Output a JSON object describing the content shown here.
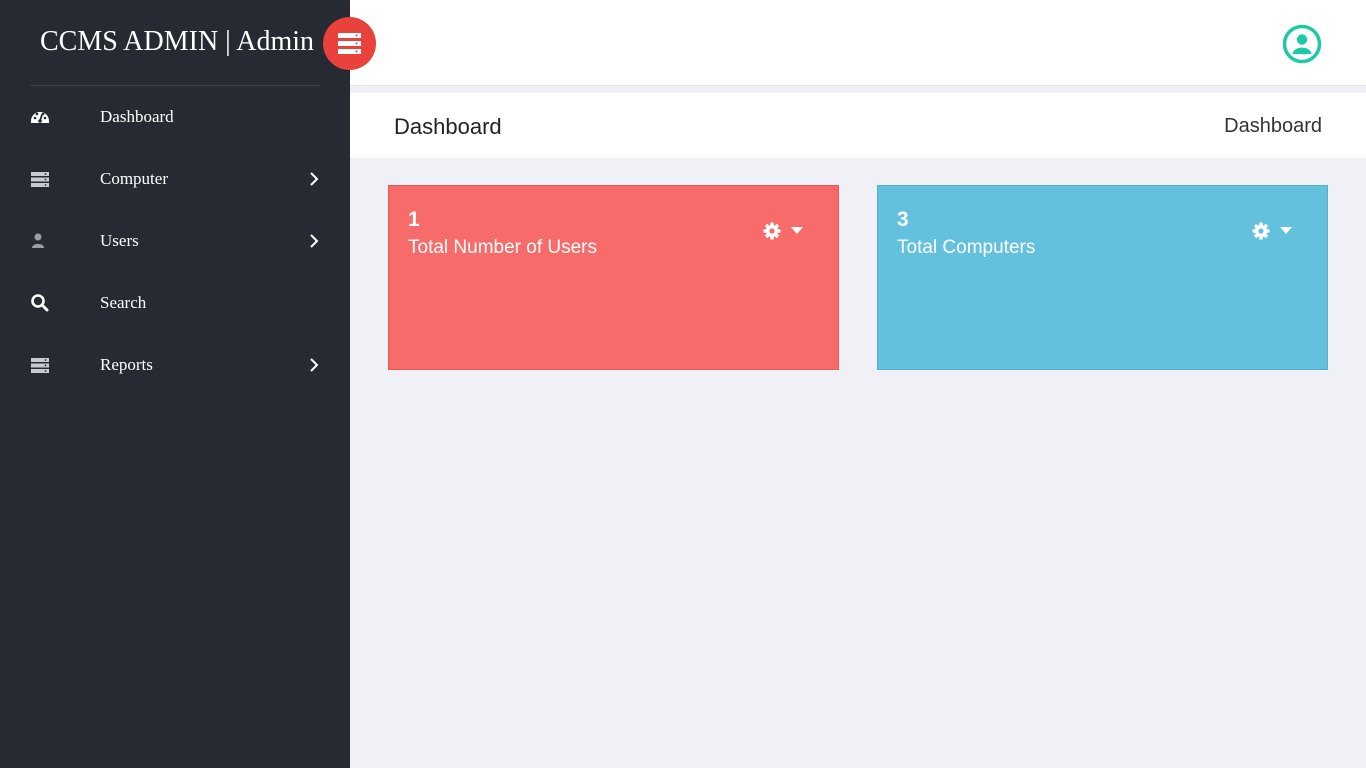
{
  "sidebar": {
    "brand_title": "CCMS ADMIN | Admin",
    "toggle_icon": "server-icon",
    "items": [
      {
        "label": "Dashboard",
        "icon": "dashboard-icon",
        "has_submenu": false
      },
      {
        "label": "Computer",
        "icon": "server-icon",
        "has_submenu": true
      },
      {
        "label": "Users",
        "icon": "user-icon",
        "has_submenu": true
      },
      {
        "label": "Search",
        "icon": "search-icon",
        "has_submenu": false
      },
      {
        "label": "Reports",
        "icon": "server-icon",
        "has_submenu": true
      }
    ]
  },
  "topbar": {
    "profile_icon": "user-circle-icon",
    "profile_color": "#1ec9a5"
  },
  "page_header": {
    "title": "Dashboard",
    "breadcrumb": "Dashboard"
  },
  "cards": [
    {
      "count": "1",
      "label": "Total Number of Users",
      "color": "#f76c6b"
    },
    {
      "count": "3",
      "label": "Total Computers",
      "color": "#63c1de"
    }
  ],
  "colors": {
    "sidebar_bg": "#262a32",
    "accent_red": "#e9413b",
    "page_bg": "#f0f1f6"
  }
}
